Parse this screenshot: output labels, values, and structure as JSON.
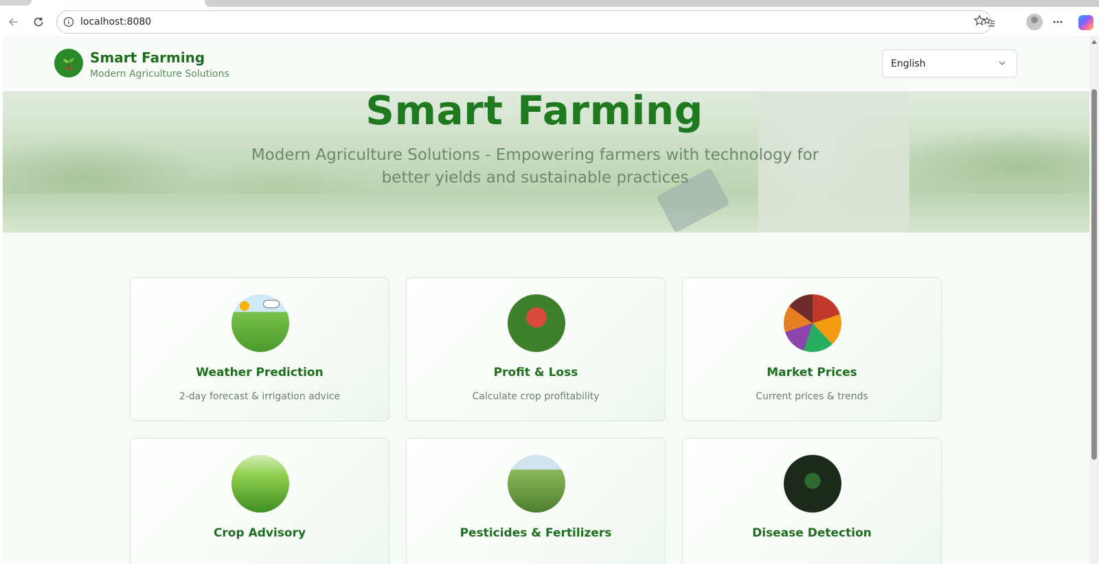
{
  "browser": {
    "url": "localhost:8080"
  },
  "header": {
    "brand_title": "Smart Farming",
    "brand_subtitle": "Modern Agriculture Solutions",
    "language": {
      "selected": "English"
    }
  },
  "hero": {
    "title": "Smart Farming",
    "subtitle": "Modern Agriculture Solutions - Empowering farmers with technology for better yields and sustainable practices"
  },
  "features": [
    {
      "title": "Weather Prediction",
      "description": "2-day forecast & irrigation advice",
      "icon": "weather-field-image"
    },
    {
      "title": "Profit & Loss",
      "description": "Calculate crop profitability",
      "icon": "farmer-image"
    },
    {
      "title": "Market Prices",
      "description": "Current prices & trends",
      "icon": "produce-market-image"
    },
    {
      "title": "Crop Advisory",
      "description": "",
      "icon": "crop-field-farmer-image"
    },
    {
      "title": "Pesticides & Fertilizers",
      "description": "",
      "icon": "sprayer-image"
    },
    {
      "title": "Disease Detection",
      "description": "",
      "icon": "leaf-magnifier-image"
    }
  ],
  "colors": {
    "brand_green": "#1f7a1f",
    "subtitle_green": "#6b8a6b",
    "card_border": "#d5e6d5"
  }
}
